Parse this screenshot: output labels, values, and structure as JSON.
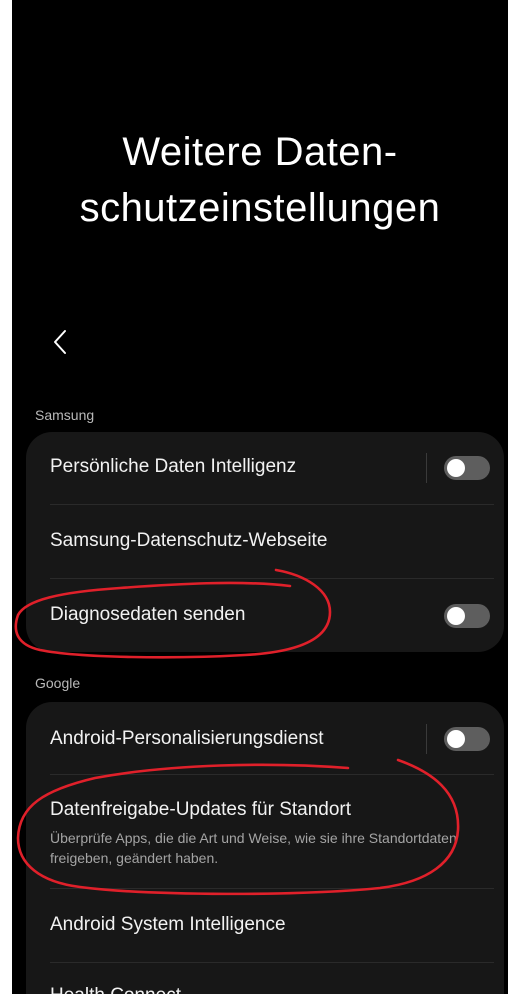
{
  "header": {
    "title_line1": "Weitere Daten-",
    "title_line2": "schutzeinstellungen"
  },
  "icons": {
    "back": "chevron-left-icon"
  },
  "sections": [
    {
      "label": "Samsung",
      "items": [
        {
          "label": "Persönliche Daten Intelligenz",
          "toggle": "off"
        },
        {
          "label": "Samsung-Datenschutz-Webseite"
        },
        {
          "label": "Diagnosedaten senden",
          "toggle": "off"
        }
      ]
    },
    {
      "label": "Google",
      "items": [
        {
          "label": "Android-Personalisierungsdienst",
          "toggle": "off"
        },
        {
          "label": "Datenfreigabe-Updates für Standort",
          "sublabel": "Überprüfe Apps, die die Art und Weise, wie sie ihre Standortdaten freigeben, geändert haben."
        },
        {
          "label": "Android System Intelligence"
        },
        {
          "label": "Health Connect"
        }
      ]
    }
  ],
  "colors": {
    "background": "#000000",
    "card": "#171717",
    "toggle_off": "#5e5e5e",
    "annotation": "#e0202a"
  }
}
